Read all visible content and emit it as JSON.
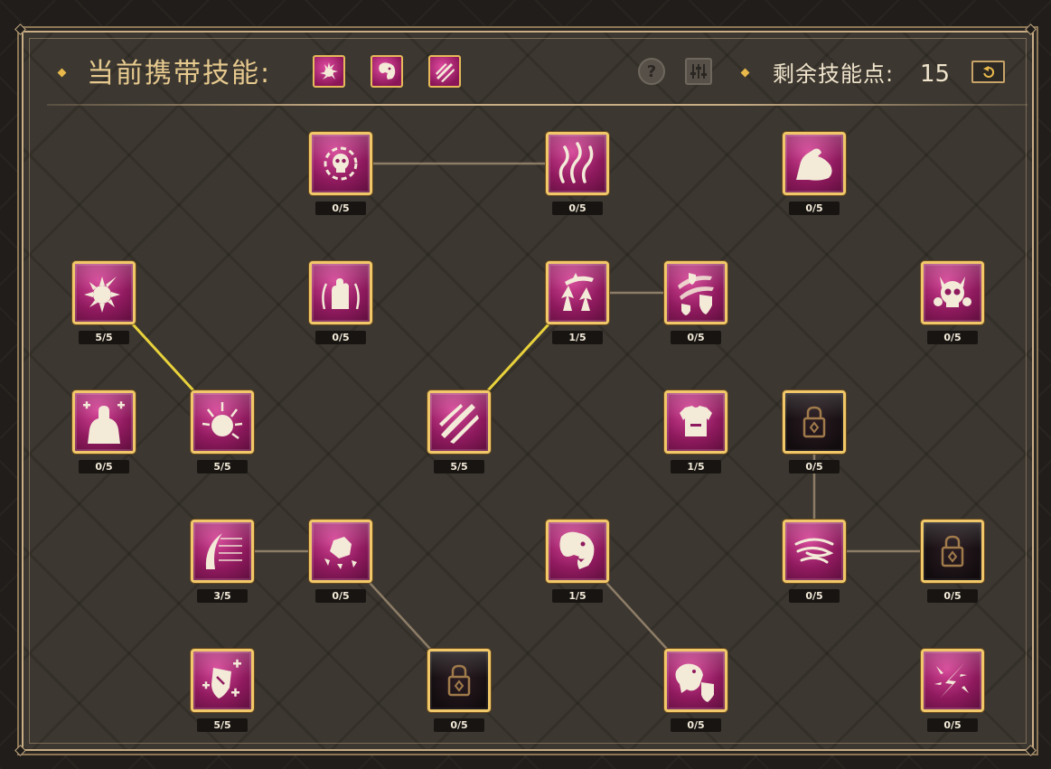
{
  "header": {
    "title": "当前携带技能:",
    "carried_skills": [
      {
        "icon": "spiked-burst-icon"
      },
      {
        "icon": "lion-head-icon"
      },
      {
        "icon": "claw-slash-icon"
      }
    ],
    "help_label": "?",
    "points_label": "剩余技能点:",
    "points_value": "15"
  },
  "colors": {
    "accent_gold": "#f0c869",
    "skill_magenta": "#b12a78",
    "active_link": "#e8d23c",
    "inactive_link": "#a8957a"
  },
  "skill_tree": {
    "nodes": [
      {
        "id": "n1",
        "icon": "poison-skull-icon",
        "level": "0/5",
        "locked": false
      },
      {
        "id": "n2",
        "icon": "flames-icon",
        "level": "0/5",
        "locked": false
      },
      {
        "id": "n3",
        "icon": "muscle-arm-icon",
        "level": "0/5",
        "locked": false
      },
      {
        "id": "n4",
        "icon": "spiked-mace-icon",
        "level": "5/5",
        "locked": false
      },
      {
        "id": "n5",
        "icon": "burning-fist-icon",
        "level": "0/5",
        "locked": false
      },
      {
        "id": "n6",
        "icon": "arrow-up-slash-icon",
        "level": "1/5",
        "locked": false
      },
      {
        "id": "n7",
        "icon": "shield-slash-icon",
        "level": "0/5",
        "locked": false
      },
      {
        "id": "n8",
        "icon": "demon-skull-icon",
        "level": "0/5",
        "locked": false
      },
      {
        "id": "n9",
        "icon": "heal-brute-icon",
        "level": "0/5",
        "locked": false
      },
      {
        "id": "n10",
        "icon": "sunburst-icon",
        "level": "5/5",
        "locked": false
      },
      {
        "id": "n11",
        "icon": "triple-claw-icon",
        "level": "5/5",
        "locked": false
      },
      {
        "id": "n12",
        "icon": "armor-icon",
        "level": "1/5",
        "locked": false
      },
      {
        "id": "n13",
        "icon": "lock-icon",
        "level": "0/5",
        "locked": true
      },
      {
        "id": "n14",
        "icon": "crescent-slash-icon",
        "level": "3/5",
        "locked": false
      },
      {
        "id": "n15",
        "icon": "rock-shatter-icon",
        "level": "0/5",
        "locked": false
      },
      {
        "id": "n16",
        "icon": "lion-head-icon",
        "level": "1/5",
        "locked": false
      },
      {
        "id": "n17",
        "icon": "whirlwind-icon",
        "level": "0/5",
        "locked": false
      },
      {
        "id": "n18",
        "icon": "lock-icon",
        "level": "0/5",
        "locked": true
      },
      {
        "id": "n19",
        "icon": "shield-plus-icon",
        "level": "5/5",
        "locked": false
      },
      {
        "id": "n20",
        "icon": "lock-icon",
        "level": "0/5",
        "locked": true
      },
      {
        "id": "n21",
        "icon": "wolf-shield-icon",
        "level": "0/5",
        "locked": false
      },
      {
        "id": "n22",
        "icon": "lightning-strike-icon",
        "level": "0/5",
        "locked": false
      }
    ],
    "links": [
      {
        "from": "n1",
        "to": "n2",
        "active": false
      },
      {
        "from": "n4",
        "to": "n10",
        "active": true
      },
      {
        "from": "n11",
        "to": "n6",
        "active": true
      },
      {
        "from": "n6",
        "to": "n7",
        "active": false
      },
      {
        "from": "n14",
        "to": "n15",
        "active": false
      },
      {
        "from": "n15",
        "to": "n20",
        "active": false
      },
      {
        "from": "n16",
        "to": "n21",
        "active": false
      },
      {
        "from": "n13",
        "to": "n17",
        "active": false
      },
      {
        "from": "n17",
        "to": "n18",
        "active": false
      }
    ]
  }
}
